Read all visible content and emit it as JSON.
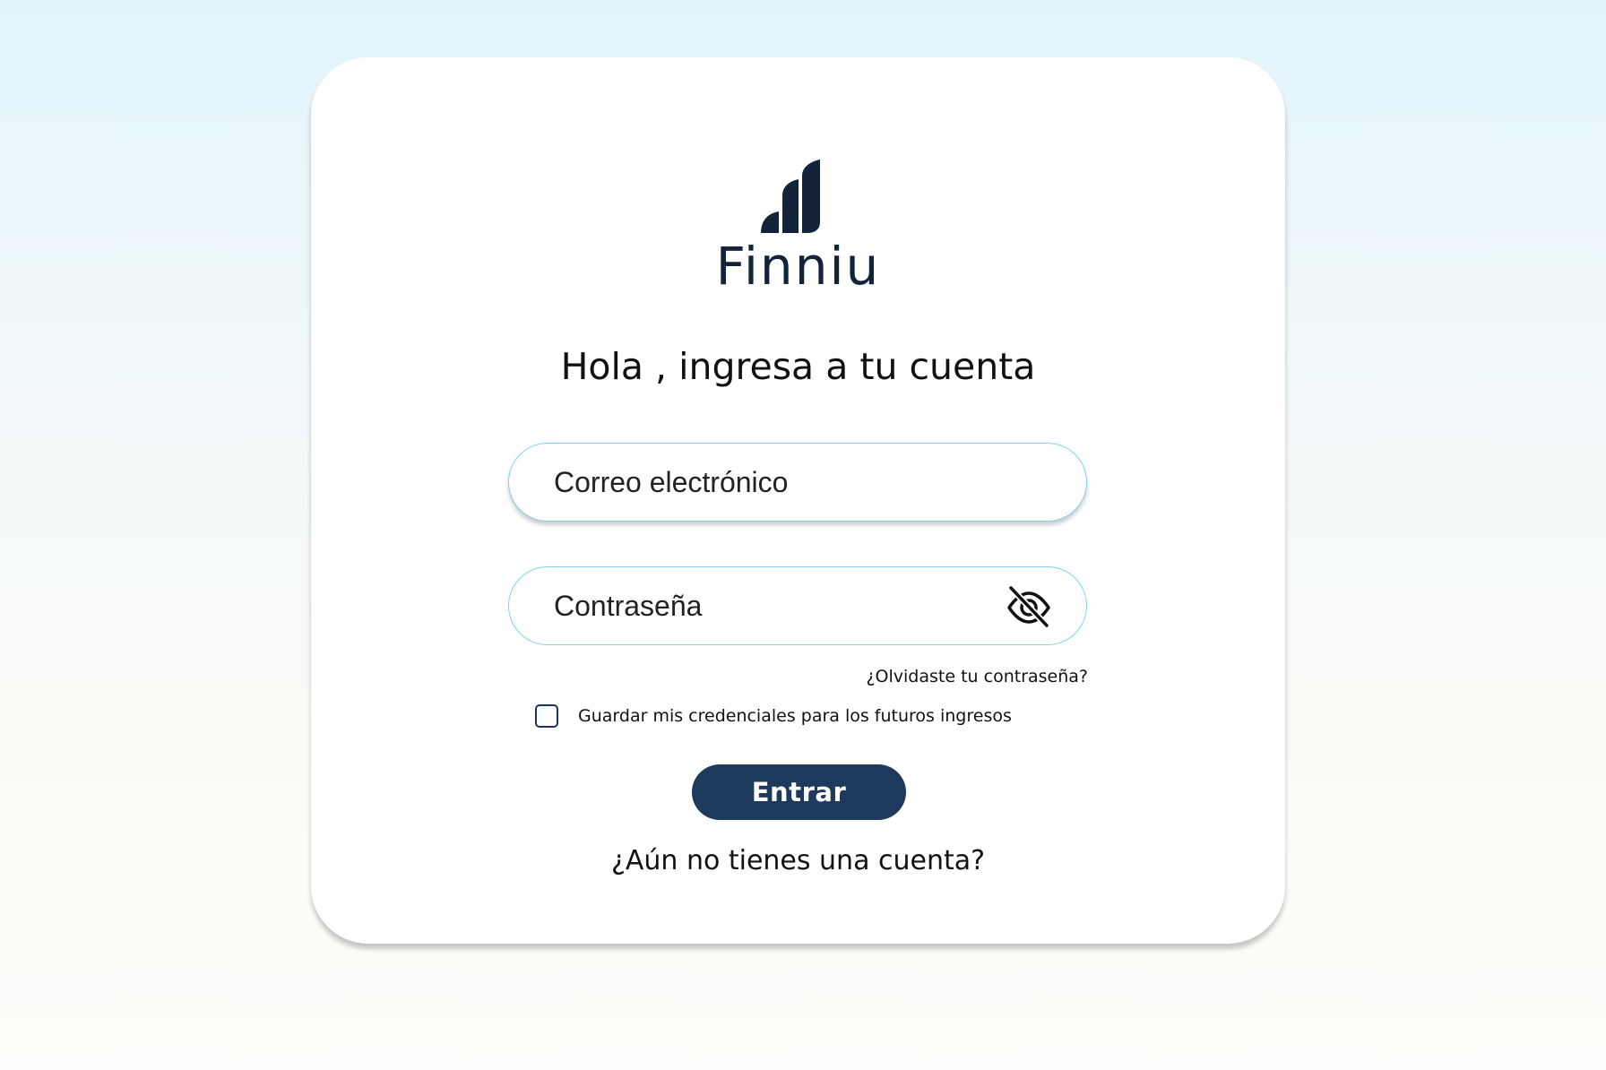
{
  "brand": {
    "name": "Finniu",
    "logo_icon": "finniu-bars-logo",
    "color": "#13243a"
  },
  "login": {
    "title": "Hola , ingresa a tu cuenta",
    "email_placeholder": "Correo electrónico",
    "password_placeholder": "Contraseña",
    "password_visibility_icon": "eye-slash-icon",
    "forgot_password": "¿Olvidaste tu contraseña?",
    "remember_label": "Guardar mis credenciales para los futuros ingresos",
    "remember_checked": false,
    "submit_label": "Entrar",
    "signup_link": "¿Aún no tienes una cuenta?"
  },
  "colors": {
    "primary_button": "#1d3a5c",
    "input_border": "#7fd3ef",
    "background_top": "#e2f4fb",
    "background_bottom": "#fdfdfb"
  }
}
